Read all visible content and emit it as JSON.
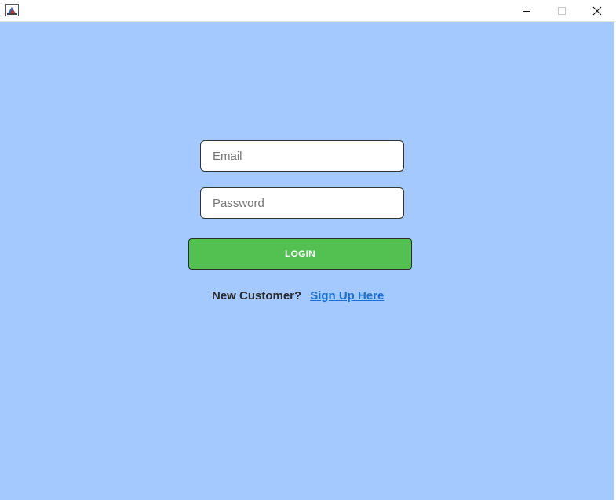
{
  "window": {
    "controls": {
      "minimize_icon": "minimize-icon",
      "maximize_icon": "maximize-icon",
      "close_icon": "close-icon"
    }
  },
  "login_form": {
    "email": {
      "value": "",
      "placeholder": "Email"
    },
    "password": {
      "value": "",
      "placeholder": "Password"
    },
    "login_label": "LOGIN",
    "new_customer_text": "New Customer?",
    "signup_link_text": "Sign Up Here"
  },
  "colors": {
    "background": "#a3c9fe",
    "login_button": "#52c152",
    "link": "#1a6fd6"
  }
}
